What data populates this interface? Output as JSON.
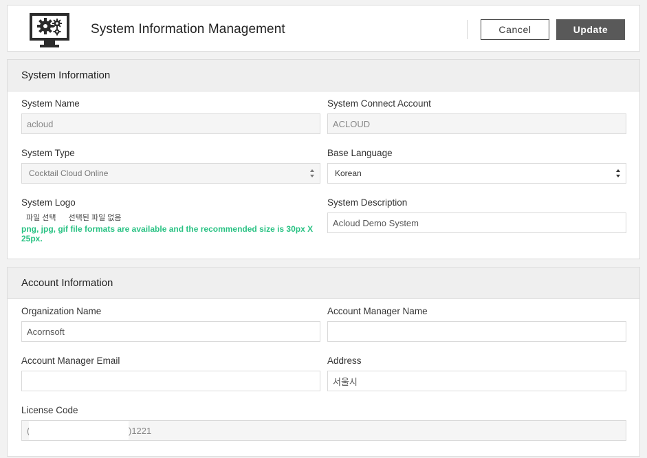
{
  "header": {
    "title": "System Information Management",
    "cancel_label": "Cancel",
    "update_label": "Update"
  },
  "system_info": {
    "heading": "System Information",
    "system_name": {
      "label": "System Name",
      "value": "acloud"
    },
    "connect_account": {
      "label": "System Connect Account",
      "value": "ACLOUD"
    },
    "system_type": {
      "label": "System Type",
      "value": "Cocktail Cloud Online"
    },
    "base_language": {
      "label": "Base Language",
      "value": "Korean"
    },
    "system_logo": {
      "label": "System Logo",
      "file_button": "파일 선택",
      "file_status": "선택된 파일 없음",
      "hint": "png, jpg, gif file formats are available and the recommended size is 30px X 25px."
    },
    "system_description": {
      "label": "System Description",
      "value": "Acloud Demo System"
    }
  },
  "account_info": {
    "heading": "Account Information",
    "organization_name": {
      "label": "Organization Name",
      "value": "Acornsoft"
    },
    "manager_name": {
      "label": "Account Manager Name",
      "value": ""
    },
    "manager_email": {
      "label": "Account Manager Email",
      "value": ""
    },
    "address": {
      "label": "Address",
      "value": "서울시"
    },
    "license_code": {
      "label": "License Code",
      "value_start": "(",
      "value_end": ")1221"
    }
  },
  "colors": {
    "hint_green": "#28c283",
    "update_button": "#595959",
    "panel_header": "#efefef"
  }
}
